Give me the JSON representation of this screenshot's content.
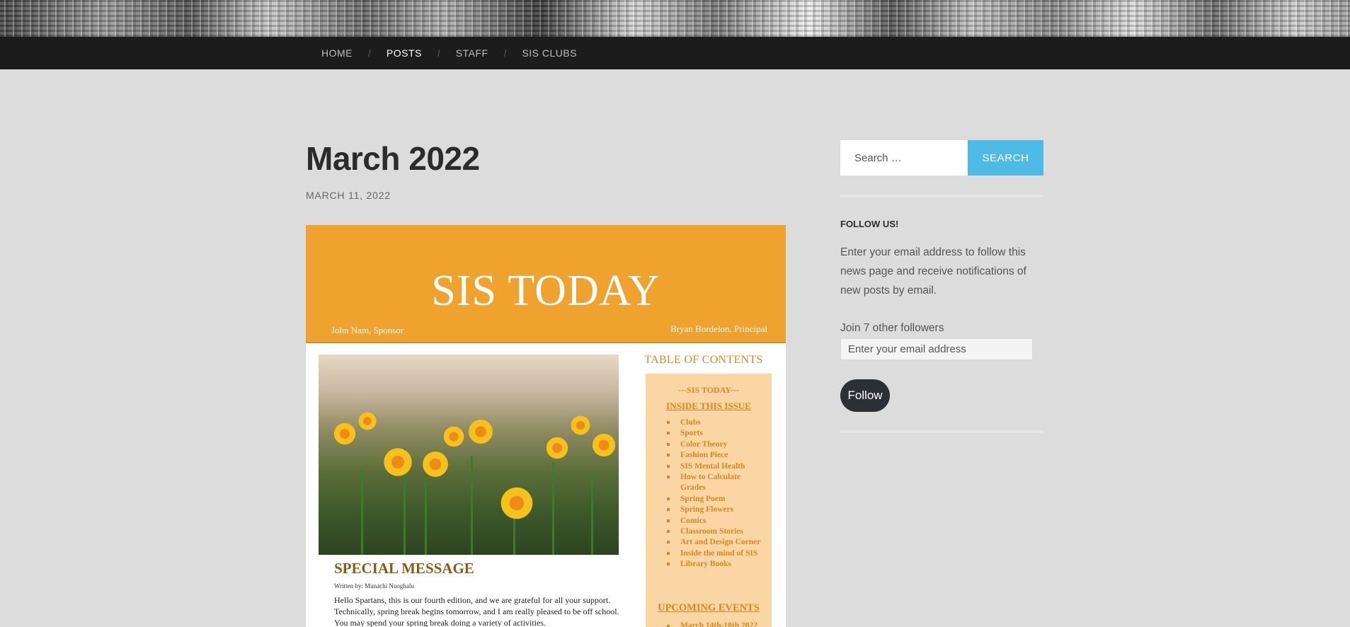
{
  "nav": {
    "items": [
      {
        "label": "HOME",
        "active": false
      },
      {
        "label": "POSTS",
        "active": true
      },
      {
        "label": "STAFF",
        "active": false
      },
      {
        "label": "SIS CLUBS",
        "active": false
      }
    ],
    "separator": "/"
  },
  "post": {
    "title": "March 2022",
    "date": "MARCH 11, 2022"
  },
  "newsletter": {
    "title": "SIS TODAY",
    "sponsor": "John Nam, Sponsor",
    "principal": "Bryan Bordelon, Principal",
    "photo_alt": "Yellow daffodils",
    "section_heading": "SPECIAL MESSAGE",
    "byline": "Written by: Munachi Nuoghalu",
    "body": "Hello Spartans, this is our fourth edition, and we are grateful for all your support. Technically, spring break begins tomorrow, and I am really pleased to be off school. You may spend your spring break doing a variety of activities.",
    "toc": {
      "heading": "TABLE OF CONTENTS",
      "sub1": "---SIS TODAY---",
      "sub2": "INSIDE THIS ISSUE",
      "items": [
        "Clubs",
        "Sports",
        "Color Theory",
        "Fashion Piece",
        "SIS Mental Health",
        "How to Calculate Grades",
        "Spring Poem",
        "Spring Flowers",
        "Comics",
        "Classroom Stories",
        "Art and Design Corner",
        "Inside the mind of SIS",
        "Library Books"
      ],
      "events_heading": "UPCOMING EVENTS",
      "event_item": "March 14th-18th 2022"
    }
  },
  "sidebar": {
    "search_placeholder": "Search …",
    "search_button": "SEARCH",
    "follow_title": "FOLLOW US!",
    "follow_desc": "Enter your email address to follow this news page and receive notifications of new posts by email.",
    "followers": "Join 7 other followers",
    "email_placeholder": "Enter your email address",
    "follow_button": "Follow"
  },
  "colors": {
    "accent": "#4ebbe6",
    "newsletter_orange": "#f0a22e",
    "navbar": "#1c1c1c",
    "background": "#dcdcdc"
  }
}
